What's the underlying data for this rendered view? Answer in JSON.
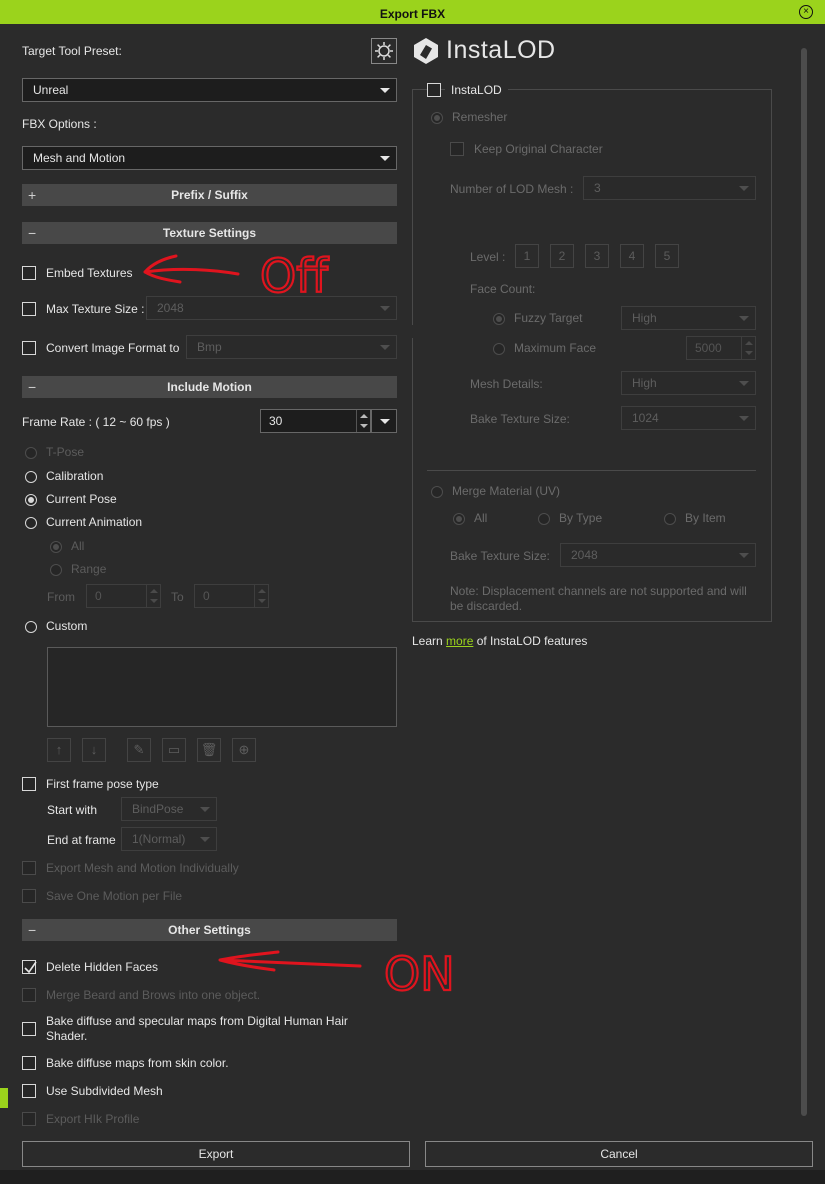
{
  "window": {
    "title": "Export FBX"
  },
  "left": {
    "target_preset_label": "Target Tool Preset:",
    "target_preset_value": "Unreal",
    "fbx_options_label": "FBX Options :",
    "fbx_options_value": "Mesh and Motion",
    "prefix_section": "Prefix / Suffix",
    "texture_section": "Texture Settings",
    "embed_textures": "Embed Textures",
    "max_texture_size": "Max Texture Size :",
    "max_texture_value": "2048",
    "convert_format": "Convert Image Format to",
    "convert_format_value": "Bmp",
    "motion_section": "Include Motion",
    "frame_rate_label": "Frame Rate : ( 12 ~ 60 fps )",
    "frame_rate_value": "30",
    "tpose": "T-Pose",
    "calibration": "Calibration",
    "current_pose": "Current Pose",
    "current_animation": "Current Animation",
    "all": "All",
    "range": "Range",
    "from": "From",
    "from_value": "0",
    "to": "To",
    "to_value": "0",
    "custom": "Custom",
    "first_frame": "First frame pose type",
    "start_with": "Start with",
    "start_with_value": "BindPose",
    "end_at_frame": "End at frame",
    "end_at_value": "1(Normal)",
    "export_individually": "Export Mesh and Motion Individually",
    "save_one_motion": "Save One Motion per File",
    "other_section": "Other Settings",
    "delete_hidden": "Delete Hidden Faces",
    "merge_beard": "Merge Beard and Brows into one object.",
    "bake_hair": "Bake diffuse and specular maps from Digital Human Hair Shader.",
    "bake_skin": "Bake diffuse maps from skin color.",
    "use_subdivided": "Use Subdivided Mesh",
    "export_hik": "Export HIk Profile"
  },
  "right": {
    "logo_text": "InstaLOD",
    "instalod_checkbox": "InstaLOD",
    "remesher": "Remesher",
    "keep_original": "Keep Original Character",
    "num_lod_label": "Number of LOD Mesh :",
    "num_lod_value": "3",
    "level_label": "Level :",
    "levels": [
      "1",
      "2",
      "3",
      "4",
      "5"
    ],
    "face_count": "Face Count:",
    "fuzzy_target": "Fuzzy Target",
    "fuzzy_value": "High",
    "maximum_face": "Maximum Face",
    "maximum_face_value": "5000",
    "mesh_details_label": "Mesh Details:",
    "mesh_details_value": "High",
    "bake_tex_label": "Bake Texture Size:",
    "bake_tex_value": "1024",
    "merge_material": "Merge Material (UV)",
    "mm_all": "All",
    "mm_by_type": "By Type",
    "mm_by_item": "By Item",
    "mm_bake_tex_label": "Bake Texture Size:",
    "mm_bake_tex_value": "2048",
    "note": "Note: Displacement channels are not supported and will be discarded.",
    "learn_prefix": "Learn ",
    "learn_link": "more",
    "learn_suffix": " of InstaLOD features"
  },
  "annotations": {
    "off": "Off",
    "on": "ON"
  },
  "footer": {
    "export": "Export",
    "cancel": "Cancel"
  },
  "colors": {
    "accent": "#9bd31c",
    "annotation": "#e0141e"
  }
}
